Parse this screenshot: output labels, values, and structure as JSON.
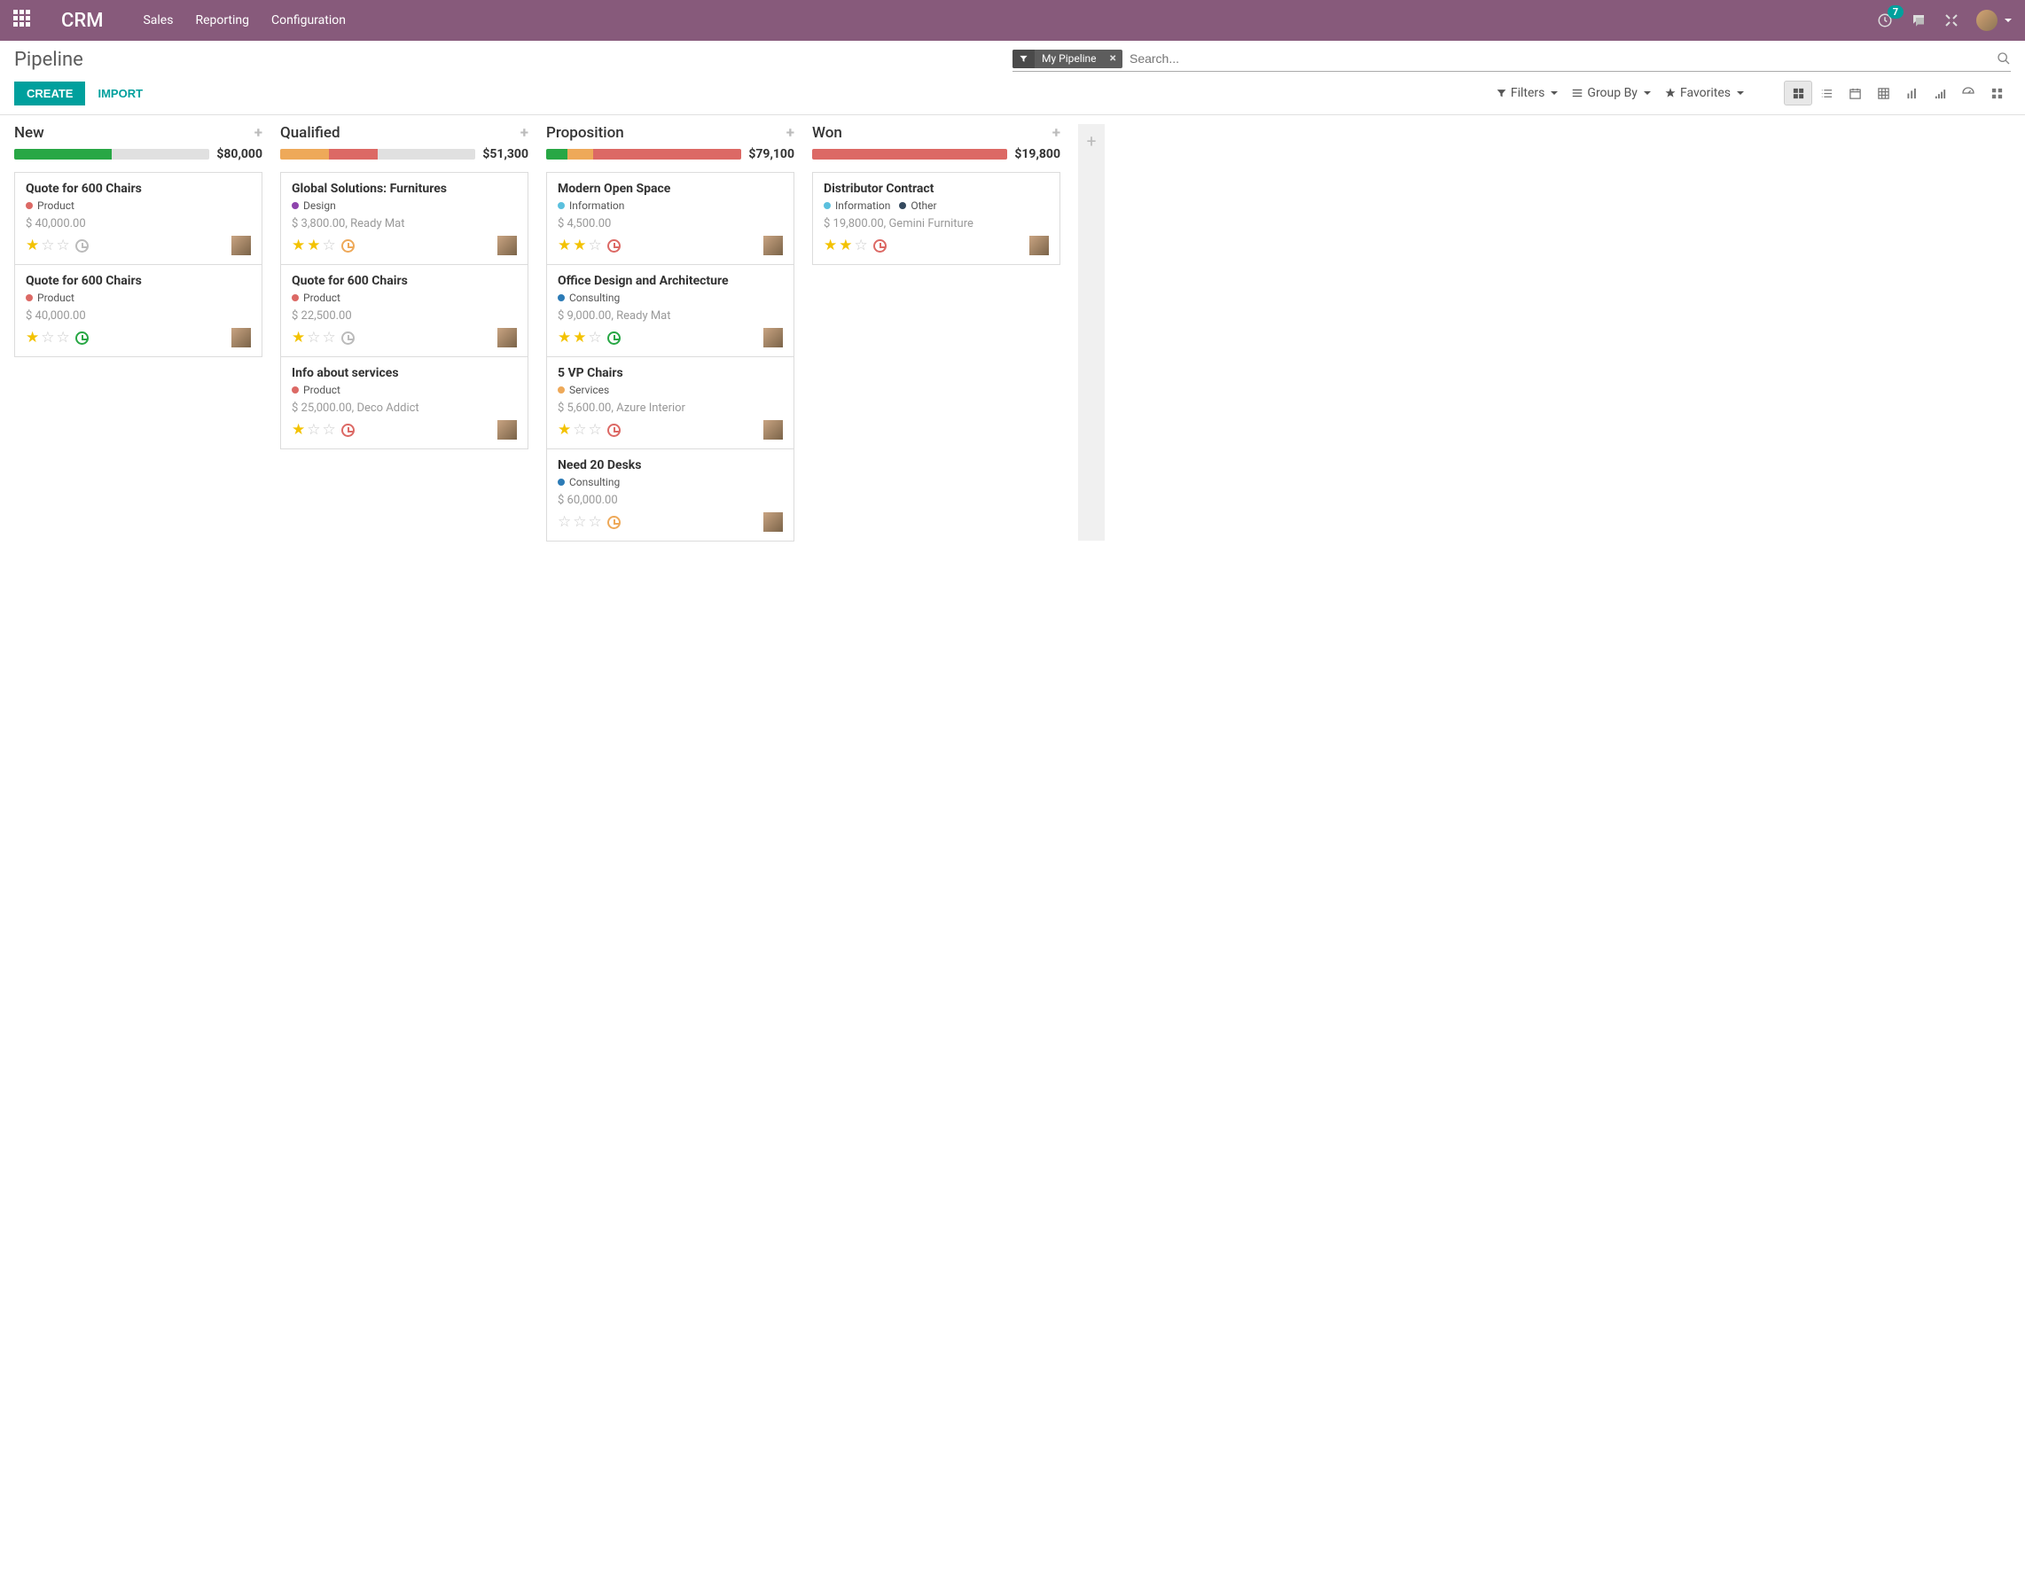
{
  "navbar": {
    "brand": "CRM",
    "menu": [
      "Sales",
      "Reporting",
      "Configuration"
    ],
    "notification_count": "7"
  },
  "control_panel": {
    "breadcrumb": "Pipeline",
    "facet_label": "My Pipeline",
    "search_placeholder": "Search...",
    "create_label": "CREATE",
    "import_label": "IMPORT",
    "filters_label": "Filters",
    "groupby_label": "Group By",
    "favorites_label": "Favorites"
  },
  "columns": [
    {
      "title": "New",
      "total": "$80,000",
      "progress": [
        {
          "color": "#28a745",
          "width": "50%"
        }
      ],
      "cards": [
        {
          "title": "Quote for 600 Chairs",
          "tags": [
            {
              "color": "#dc6965",
              "label": "Product"
            }
          ],
          "sub": "$ 40,000.00",
          "stars": 1,
          "activity_color": "#bbb"
        },
        {
          "title": "Quote for 600 Chairs",
          "tags": [
            {
              "color": "#dc6965",
              "label": "Product"
            }
          ],
          "sub": "$ 40,000.00",
          "stars": 1,
          "activity_color": "#28a745"
        }
      ]
    },
    {
      "title": "Qualified",
      "total": "$51,300",
      "progress": [
        {
          "color": "#eea959",
          "width": "25%"
        },
        {
          "color": "#dc6965",
          "width": "25%"
        }
      ],
      "cards": [
        {
          "title": "Global Solutions: Furnitures",
          "tags": [
            {
              "color": "#8e44ad",
              "label": "Design"
            }
          ],
          "sub": "$ 3,800.00, Ready Mat",
          "stars": 2,
          "activity_color": "#eea959"
        },
        {
          "title": "Quote for 600 Chairs",
          "tags": [
            {
              "color": "#dc6965",
              "label": "Product"
            }
          ],
          "sub": "$ 22,500.00",
          "stars": 1,
          "activity_color": "#bbb"
        },
        {
          "title": "Info about services",
          "tags": [
            {
              "color": "#dc6965",
              "label": "Product"
            }
          ],
          "sub": "$ 25,000.00, Deco Addict",
          "stars": 1,
          "activity_color": "#dc6965"
        }
      ]
    },
    {
      "title": "Proposition",
      "total": "$79,100",
      "progress": [
        {
          "color": "#28a745",
          "width": "11%"
        },
        {
          "color": "#eea959",
          "width": "13%"
        },
        {
          "color": "#dc6965",
          "width": "76%"
        }
      ],
      "cards": [
        {
          "title": "Modern Open Space",
          "tags": [
            {
              "color": "#5bc0de",
              "label": "Information"
            }
          ],
          "sub": "$ 4,500.00",
          "stars": 2,
          "activity_color": "#dc6965"
        },
        {
          "title": "Office Design and Architecture",
          "tags": [
            {
              "color": "#2c7bb6",
              "label": "Consulting"
            }
          ],
          "sub": "$ 9,000.00, Ready Mat",
          "stars": 2,
          "activity_color": "#28a745"
        },
        {
          "title": "5 VP Chairs",
          "tags": [
            {
              "color": "#eea959",
              "label": "Services"
            }
          ],
          "sub": "$ 5,600.00, Azure Interior",
          "stars": 1,
          "activity_color": "#dc6965"
        },
        {
          "title": "Need 20 Desks",
          "tags": [
            {
              "color": "#2c7bb6",
              "label": "Consulting"
            }
          ],
          "sub": "$ 60,000.00",
          "stars": 0,
          "activity_color": "#eea959"
        }
      ]
    },
    {
      "title": "Won",
      "total": "$19,800",
      "progress": [
        {
          "color": "#dc6965",
          "width": "100%"
        }
      ],
      "cards": [
        {
          "title": "Distributor Contract",
          "tags": [
            {
              "color": "#5bc0de",
              "label": "Information"
            },
            {
              "color": "#34495e",
              "label": "Other"
            }
          ],
          "sub": "$ 19,800.00, Gemini Furniture",
          "stars": 2,
          "activity_color": "#dc6965"
        }
      ]
    }
  ]
}
